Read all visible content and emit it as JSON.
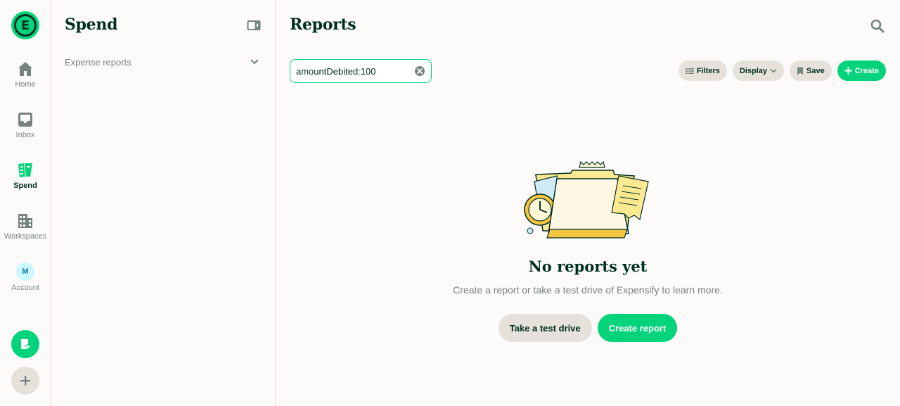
{
  "colors": {
    "accent": "#03d47c",
    "text_primary": "#002e22",
    "text_muted": "#76847e",
    "border": "#e6e1da",
    "background": "#fcfbf9"
  },
  "nav": {
    "logo_letter": "E",
    "items": [
      {
        "label": "Home",
        "icon": "home-icon"
      },
      {
        "label": "Inbox",
        "icon": "inbox-icon"
      },
      {
        "label": "Spend",
        "icon": "receipt-icon",
        "active": true
      },
      {
        "label": "Workspaces",
        "icon": "building-icon"
      },
      {
        "label": "Account",
        "icon": "avatar",
        "avatar_initial": "M"
      }
    ],
    "fab_icons": [
      "new-expense-icon",
      "plus-icon"
    ]
  },
  "sidebar": {
    "title": "Spend",
    "items": [
      {
        "label": "Expense reports",
        "icon": "chevron-down-icon"
      }
    ]
  },
  "main": {
    "title": "Reports",
    "search_query": "amountDebited:100",
    "toolbar": {
      "filters_label": "Filters",
      "display_label": "Display",
      "save_label": "Save",
      "create_label": "Create"
    },
    "empty_state": {
      "title": "No reports yet",
      "subtitle": "Create a report or take a test drive of Expensify to learn more.",
      "test_drive_label": "Take a test drive",
      "create_report_label": "Create report"
    }
  }
}
